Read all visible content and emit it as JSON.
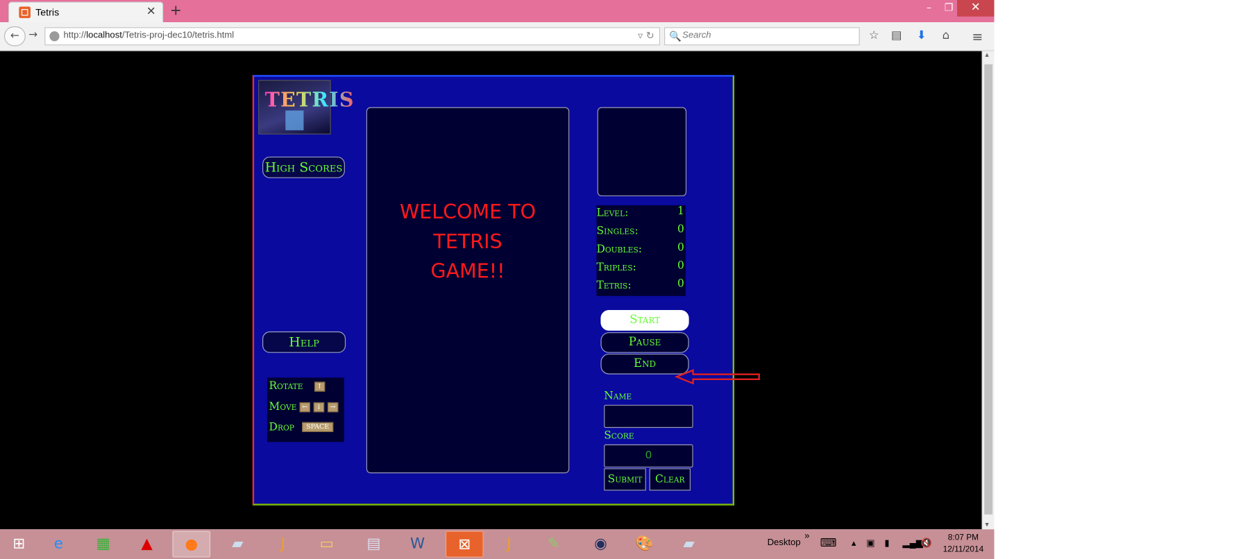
{
  "browser": {
    "tab_title": "Tetris",
    "url_prefix": "http://",
    "url_host": "localhost",
    "url_path": "/Tetris-proj-dec10/tetris.html",
    "search_placeholder": "Search"
  },
  "game": {
    "logo_text": "TETRIS",
    "high_scores_label": "High Scores",
    "help_label": "Help",
    "controls": [
      {
        "label": "Rotate",
        "keys": [
          "↑"
        ]
      },
      {
        "label": "Move",
        "keys": [
          "←",
          "↓",
          "→"
        ]
      },
      {
        "label": "Drop",
        "keys": [
          "SPACE"
        ]
      }
    ],
    "welcome_line1": "WELCOME TO TETRIS",
    "welcome_line2": "GAME!!",
    "stats": [
      {
        "label": "Level:",
        "value": "1"
      },
      {
        "label": "Singles:",
        "value": "0"
      },
      {
        "label": "Doubles:",
        "value": "0"
      },
      {
        "label": "Triples:",
        "value": "0"
      },
      {
        "label": "Tetris:",
        "value": "0"
      }
    ],
    "start_label": "Start",
    "pause_label": "Pause",
    "end_label": "End",
    "name_label": "Name",
    "name_value": "",
    "score_label": "Score",
    "score_value": "0",
    "submit_label": "Submit",
    "clear_label": "Clear"
  },
  "taskbar": {
    "desktop_label": "Desktop",
    "time": "8:07 PM",
    "date": "12/11/2014"
  },
  "colors": {
    "game_bg": "#0a0a9e",
    "panel_bg": "#000033",
    "text_green": "#66ff33",
    "welcome_red": "#ff1a1a",
    "annotation_arrow": "#e02020"
  }
}
